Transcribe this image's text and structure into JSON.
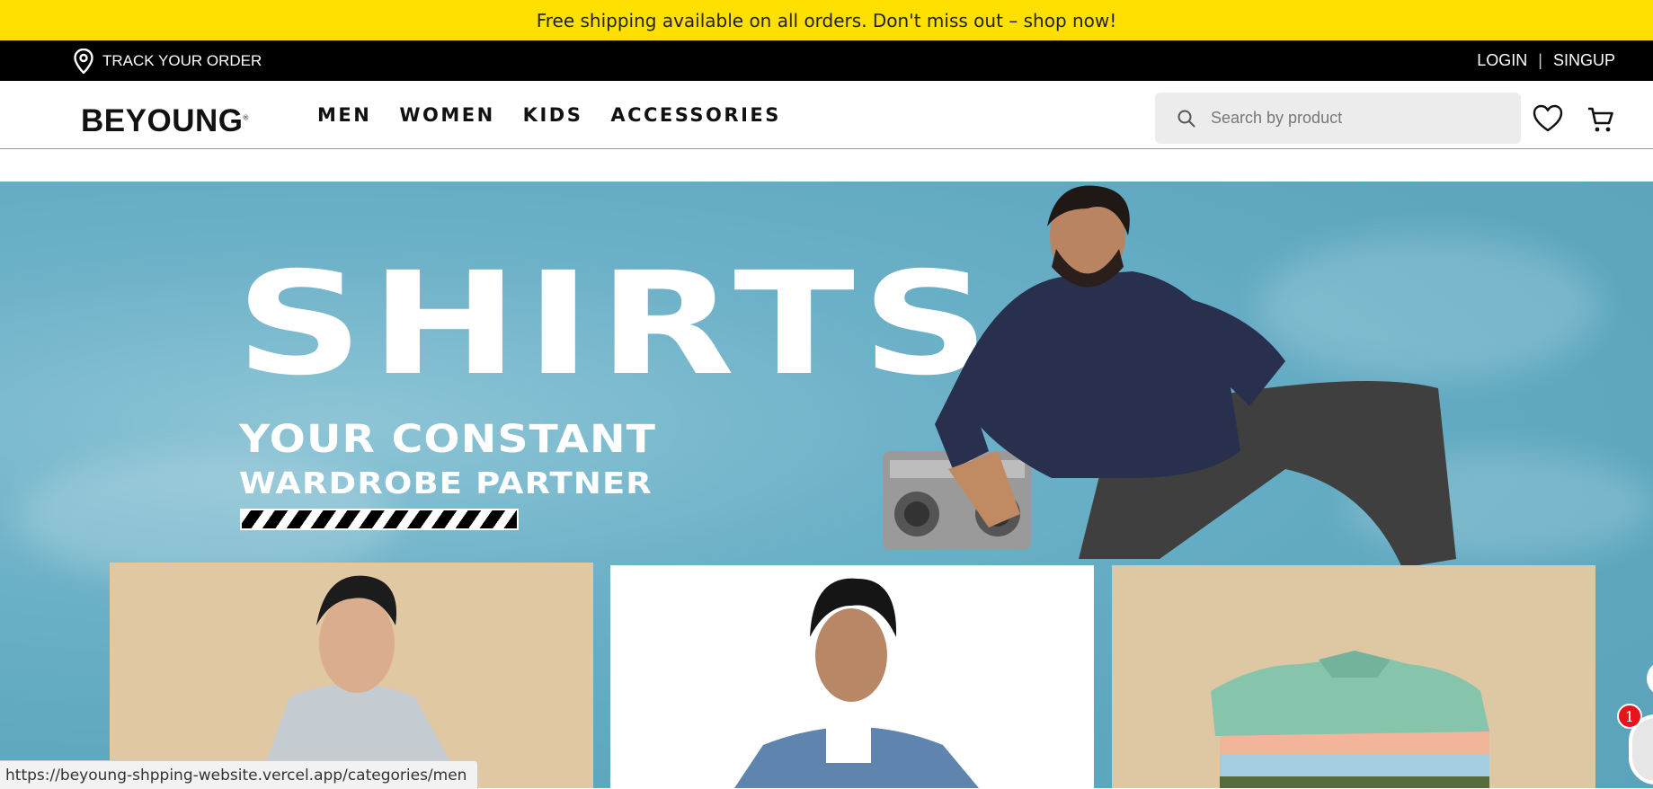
{
  "announcement": {
    "text": "Free shipping available on all orders. Don't miss out – shop now!"
  },
  "topbar": {
    "track_label": "TRACK YOUR ORDER",
    "login_label": "LOGIN",
    "signup_label": "SINGUP"
  },
  "header": {
    "logo": "BEYOUNG",
    "logo_mark": "®",
    "nav": [
      {
        "label": "MEN"
      },
      {
        "label": "WOMEN"
      },
      {
        "label": "KIDS"
      },
      {
        "label": "ACCESSORIES"
      }
    ],
    "search_placeholder": "Search by product",
    "search_value": ""
  },
  "hero": {
    "title": "SHIRTS",
    "subtitle_line1": "YOUR CONSTANT",
    "subtitle_line2": "WARDROBE PARTNER"
  },
  "chat_widget": {
    "badge_count": "1"
  },
  "status_bar": {
    "url": "https://beyoung-shpping-website.vercel.app/categories/men"
  },
  "colors": {
    "announcement_bg": "#FFE000",
    "topbar_bg": "#000000",
    "hero_bg": "#5DA7BF",
    "card_beige": "#DFC8A2",
    "badge": "#E8141B"
  },
  "icons": [
    "location-pin-icon",
    "search-icon",
    "heart-icon",
    "cart-icon"
  ]
}
